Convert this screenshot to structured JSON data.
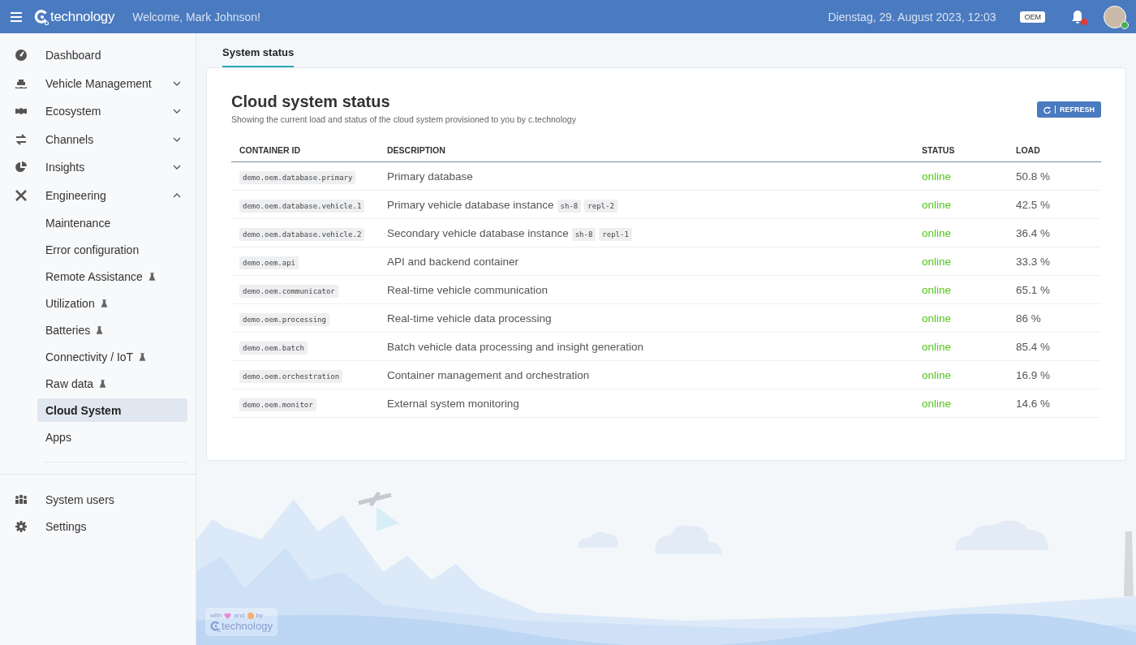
{
  "header": {
    "logo_text": "technology",
    "welcome": "Welcome, Mark Johnson!",
    "datetime": "Dienstag, 29. August 2023, 12:03",
    "role": "OEM",
    "notifications_unread": true,
    "user_online": true
  },
  "sidebar": {
    "items": [
      {
        "label": "Dashboard",
        "kind": "link",
        "selected": false
      },
      {
        "label": "Vehicle Management",
        "kind": "group",
        "expanded": false,
        "selected": false
      },
      {
        "label": "Ecosystem",
        "kind": "group",
        "expanded": false,
        "selected": false
      },
      {
        "label": "Channels",
        "kind": "group",
        "expanded": false,
        "selected": false
      },
      {
        "label": "Insights",
        "kind": "group",
        "expanded": false,
        "selected": false
      },
      {
        "label": "Engineering",
        "kind": "group",
        "expanded": true,
        "selected": false,
        "children": [
          {
            "label": "Maintenance",
            "experimental": false,
            "selected": false
          },
          {
            "label": "Error configuration",
            "experimental": false,
            "selected": false
          },
          {
            "label": "Remote Assistance",
            "experimental": true,
            "selected": false
          },
          {
            "label": "Utilization",
            "experimental": true,
            "selected": false
          },
          {
            "label": "Batteries",
            "experimental": true,
            "selected": false
          },
          {
            "label": "Connectivity / IoT",
            "experimental": true,
            "selected": false
          },
          {
            "label": "Raw data",
            "experimental": true,
            "selected": false
          },
          {
            "label": "Cloud System",
            "experimental": false,
            "selected": true
          },
          {
            "label": "Apps",
            "experimental": false,
            "selected": false
          }
        ]
      }
    ],
    "bottom_items": [
      {
        "label": "System users",
        "selected": false
      },
      {
        "label": "Settings",
        "selected": false
      }
    ]
  },
  "tabs": [
    {
      "label": "System status",
      "selected": true
    }
  ],
  "card": {
    "title": "Cloud system status",
    "subtitle": "Showing the current load and status of the cloud system provisioned to you by c.technology",
    "refresh_button": "REFRESH"
  },
  "table": {
    "columns": [
      "CONTAINER ID",
      "DESCRIPTION",
      "STATUS",
      "LOAD"
    ],
    "rows": [
      {
        "container_id": "demo.oem.database.primary",
        "description": "Primary database",
        "tags": [],
        "status": "online",
        "load": "50.8 %"
      },
      {
        "container_id": "demo.oem.database.vehicle.1",
        "description": "Primary vehicle database instance",
        "tags": [
          "sh-8",
          "repl-2"
        ],
        "status": "online",
        "load": "42.5 %"
      },
      {
        "container_id": "demo.oem.database.vehicle.2",
        "description": "Secondary vehicle database instance",
        "tags": [
          "sh-8",
          "repl-1"
        ],
        "status": "online",
        "load": "36.4 %"
      },
      {
        "container_id": "demo.oem.api",
        "description": "API and backend container",
        "tags": [],
        "status": "online",
        "load": "33.3 %"
      },
      {
        "container_id": "demo.oem.communicator",
        "description": "Real-time vehicle communication",
        "tags": [],
        "status": "online",
        "load": "65.1 %"
      },
      {
        "container_id": "demo.oem.processing",
        "description": "Real-time vehicle data processing",
        "tags": [],
        "status": "online",
        "load": "86 %"
      },
      {
        "container_id": "demo.oem.batch",
        "description": "Batch vehicle data processing and insight generation",
        "tags": [],
        "status": "online",
        "load": "85.4 %"
      },
      {
        "container_id": "demo.oem.orchestration",
        "description": "Container management and orchestration",
        "tags": [],
        "status": "online",
        "load": "16.9 %"
      },
      {
        "container_id": "demo.oem.monitor",
        "description": "External system monitoring",
        "tags": [],
        "status": "online",
        "load": "14.6 %"
      }
    ]
  },
  "footer_badge": {
    "words": [
      "with",
      "and",
      "by"
    ],
    "logo_text": "technology"
  }
}
